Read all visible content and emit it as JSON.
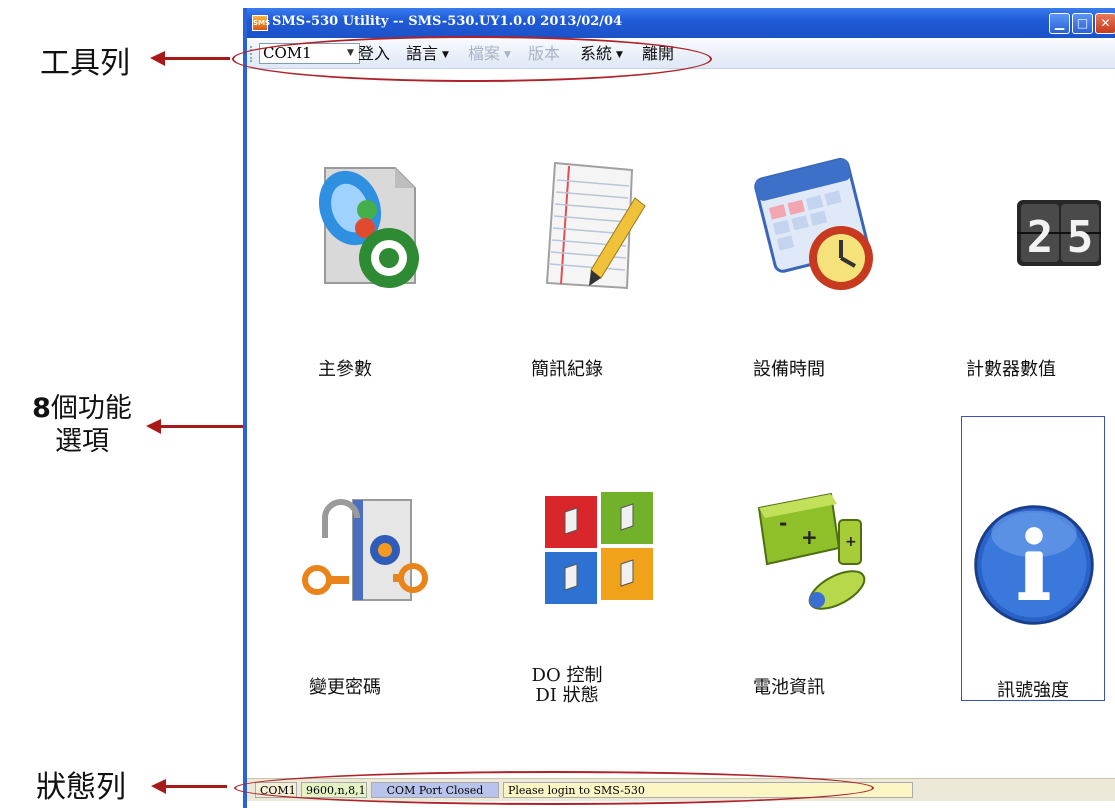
{
  "annotations": {
    "toolbar_label": "工具列",
    "features_num": "8",
    "features_label": "個功能",
    "features_label2": "選項",
    "status_label": "狀態列"
  },
  "window": {
    "title": "SMS-530 Utility -- SMS-530.UY1.0.0 2013/02/04",
    "icon_text": "SMS",
    "buttons": [
      "minimize",
      "maximize",
      "close"
    ]
  },
  "toolbar": {
    "com_port": "COM1",
    "items": [
      {
        "label": "登入",
        "dropdown": false,
        "enabled": true
      },
      {
        "label": "語言",
        "dropdown": true,
        "enabled": true
      },
      {
        "label": "檔案",
        "dropdown": true,
        "enabled": false
      },
      {
        "label": "版本",
        "dropdown": false,
        "enabled": false
      },
      {
        "label": "系統",
        "dropdown": true,
        "enabled": true
      },
      {
        "label": "離開",
        "dropdown": false,
        "enabled": true
      }
    ]
  },
  "features": [
    {
      "label": "主參數",
      "icon": "parameters-gear-icon"
    },
    {
      "label": "簡訊紀錄",
      "icon": "notepad-pencil-icon"
    },
    {
      "label": "設備時間",
      "icon": "calendar-clock-icon"
    },
    {
      "label": "計數器數值",
      "icon": "counter-display-icon",
      "counter": "25"
    },
    {
      "label": "變更密碼",
      "icon": "lock-key-icon"
    },
    {
      "label": "DO 控制\nDI 狀態",
      "icon": "switch-panel-icon"
    },
    {
      "label": "電池資訊",
      "icon": "battery-icon"
    },
    {
      "label": "訊號強度",
      "icon": "info-icon",
      "selected": true
    }
  ],
  "statusbar": {
    "port": "COM1",
    "settings": "9600,n,8,1",
    "port_state": "COM Port Closed",
    "message": "Please login to SMS-530"
  },
  "colors": {
    "titlebar": "#1f5bd6",
    "annotation_red": "#b0222a"
  }
}
